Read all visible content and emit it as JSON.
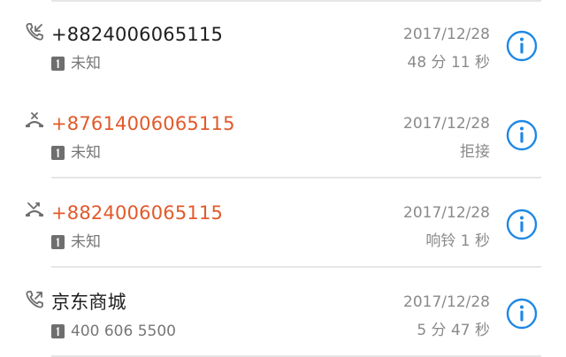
{
  "theme": {
    "missed_color": "#e2592a",
    "normal_color": "#202020",
    "info_color": "#1e88e5",
    "muted_color": "#8a8a8a"
  },
  "calls": [
    {
      "type": "rejected",
      "icon": "call-rejected-icon",
      "name": "+87614006065115",
      "sim_label": "1",
      "sub": "未知",
      "date": "2017/12/28",
      "detail": "拒接"
    },
    {
      "type": "missed",
      "icon": "call-missed-icon",
      "name": "+8824006065115",
      "sim_label": "1",
      "sub": "未知",
      "date": "2017/12/28",
      "detail": "响铃 1 秒"
    },
    {
      "type": "outgoing",
      "icon": "call-outgoing-icon",
      "name": "京东商城",
      "sim_label": "1",
      "sub": "400 606 5500",
      "date": "2017/12/28",
      "detail": "5 分 47 秒"
    },
    {
      "type": "incoming",
      "icon": "call-incoming-icon",
      "name": "+8824006065115",
      "sim_label": "1",
      "sub": "未知",
      "date": "2017/12/28",
      "detail": "48 分 11 秒"
    }
  ]
}
